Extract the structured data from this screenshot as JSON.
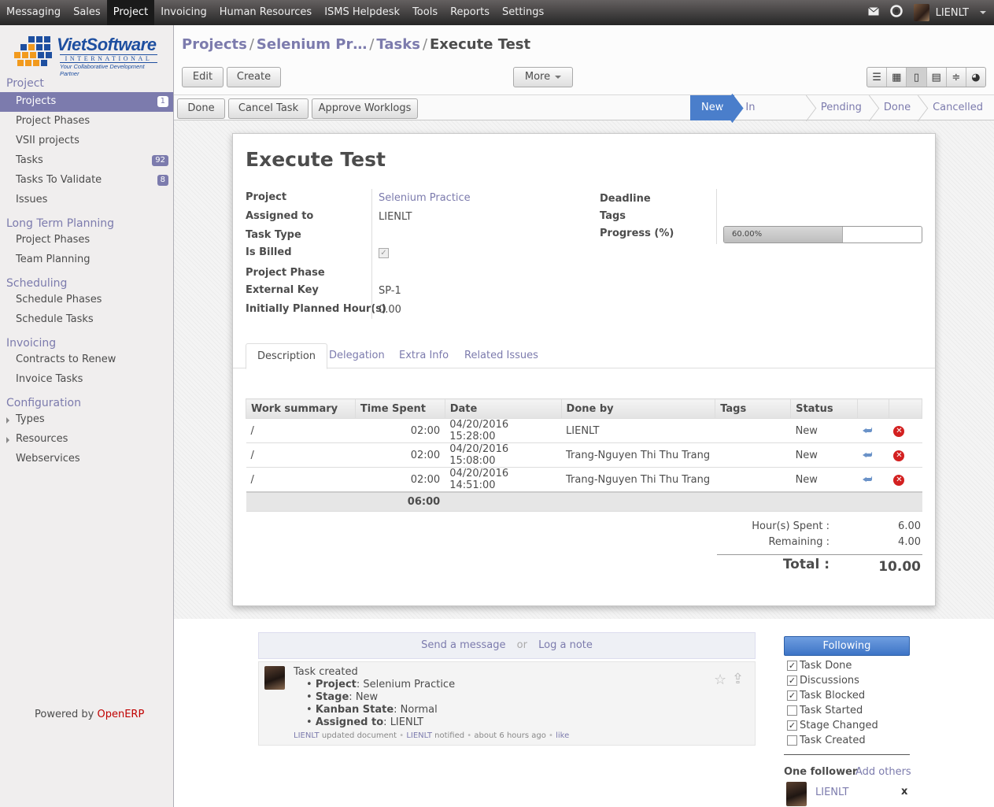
{
  "topnav": {
    "items": [
      "Messaging",
      "Sales",
      "Project",
      "Invoicing",
      "Human Resources",
      "ISMS Helpdesk",
      "Tools",
      "Reports",
      "Settings"
    ],
    "active": "Project",
    "user": "LIENLT"
  },
  "logo": {
    "name": "VietSoftware",
    "sub": "INTERNATIONAL",
    "tagline": "Your Collaborative Development Partner"
  },
  "sidebar": {
    "sections": [
      {
        "title": "Project",
        "items": [
          {
            "label": "Projects",
            "badge": "1",
            "selected": true
          },
          {
            "label": "Project Phases"
          },
          {
            "label": "VSII projects"
          },
          {
            "label": "Tasks",
            "badge": "92"
          },
          {
            "label": "Tasks To Validate",
            "badge": "8"
          },
          {
            "label": "Issues"
          }
        ]
      },
      {
        "title": "Long Term Planning",
        "items": [
          {
            "label": "Project Phases"
          },
          {
            "label": "Team Planning"
          }
        ]
      },
      {
        "title": "Scheduling",
        "items": [
          {
            "label": "Schedule Phases"
          },
          {
            "label": "Schedule Tasks"
          }
        ]
      },
      {
        "title": "Invoicing",
        "items": [
          {
            "label": "Contracts to Renew"
          },
          {
            "label": "Invoice Tasks"
          }
        ]
      },
      {
        "title": "Configuration",
        "items": [
          {
            "label": "Types",
            "expandable": true
          },
          {
            "label": "Resources",
            "expandable": true
          },
          {
            "label": "Webservices"
          }
        ]
      }
    ],
    "powered_prefix": "Powered by ",
    "powered_brand": "OpenERP"
  },
  "breadcrumb": [
    "Projects",
    "Selenium Pr…",
    "Tasks",
    "Execute Test"
  ],
  "toolbar": {
    "edit": "Edit",
    "create": "Create",
    "more": "More"
  },
  "actions": [
    "Done",
    "Cancel Task",
    "Approve Worklogs"
  ],
  "stages": [
    "New",
    "In Progress",
    "Pending",
    "Done",
    "Cancelled"
  ],
  "current_stage": "New",
  "form": {
    "title": "Execute Test",
    "labels": {
      "project": "Project",
      "assigned": "Assigned to",
      "task_type": "Task Type",
      "is_billed": "Is Billed",
      "phase": "Project Phase",
      "ext_key": "External Key",
      "planned": "Initially Planned Hour(s)",
      "deadline": "Deadline",
      "tags": "Tags",
      "progress": "Progress (%)"
    },
    "values": {
      "project": "Selenium Practice",
      "assigned": "LIENLT",
      "task_type": "",
      "is_billed": true,
      "phase": "",
      "ext_key": "SP-1",
      "planned": "0.00",
      "deadline": "",
      "tags": "",
      "progress": 60.0,
      "progress_text": "60.00%"
    }
  },
  "tabs": [
    "Description",
    "Delegation",
    "Extra Info",
    "Related Issues"
  ],
  "active_tab": "Description",
  "worklog": {
    "columns": [
      "Work summary",
      "Time Spent",
      "Date",
      "Done by",
      "Tags",
      "Status"
    ],
    "rows": [
      {
        "summary": "/",
        "time": "02:00",
        "date": "04/20/2016 15:28:00",
        "by": "LIENLT",
        "tags": "",
        "status": "New"
      },
      {
        "summary": "/",
        "time": "02:00",
        "date": "04/20/2016 15:08:00",
        "by": "Trang-Nguyen Thi Thu Trang",
        "tags": "",
        "status": "New"
      },
      {
        "summary": "/",
        "time": "02:00",
        "date": "04/20/2016 14:51:00",
        "by": "Trang-Nguyen Thi Thu Trang",
        "tags": "",
        "status": "New"
      }
    ],
    "total": "06:00"
  },
  "summary": {
    "spent_label": "Hour(s) Spent :",
    "spent": "6.00",
    "remaining_label": "Remaining :",
    "remaining": "4.00",
    "total_label": "Total :",
    "total": "10.00"
  },
  "chatter": {
    "send": "Send a message",
    "or": "or",
    "log": "Log a note",
    "message": {
      "title": "Task created",
      "lines": [
        {
          "k": "Project",
          "v": "Selenium Practice"
        },
        {
          "k": "Stage",
          "v": "New"
        },
        {
          "k": "Kanban State",
          "v": "Normal"
        },
        {
          "k": "Assigned to",
          "v": "LIENLT"
        }
      ],
      "footer": {
        "author": "LIENLT",
        "updated": "updated document",
        "notified_user": "LIENLT",
        "notified": "notified",
        "time": "about 6 hours ago",
        "like": "like"
      }
    }
  },
  "followers": {
    "button": "Following",
    "subtypes": [
      {
        "label": "Task Done",
        "checked": true
      },
      {
        "label": "Discussions",
        "checked": true
      },
      {
        "label": "Task Blocked",
        "checked": true
      },
      {
        "label": "Task Started",
        "checked": false
      },
      {
        "label": "Stage Changed",
        "checked": true
      },
      {
        "label": "Task Created",
        "checked": false
      }
    ],
    "count_label": "One follower",
    "add": "Add others",
    "list": [
      "LIENLT"
    ]
  }
}
